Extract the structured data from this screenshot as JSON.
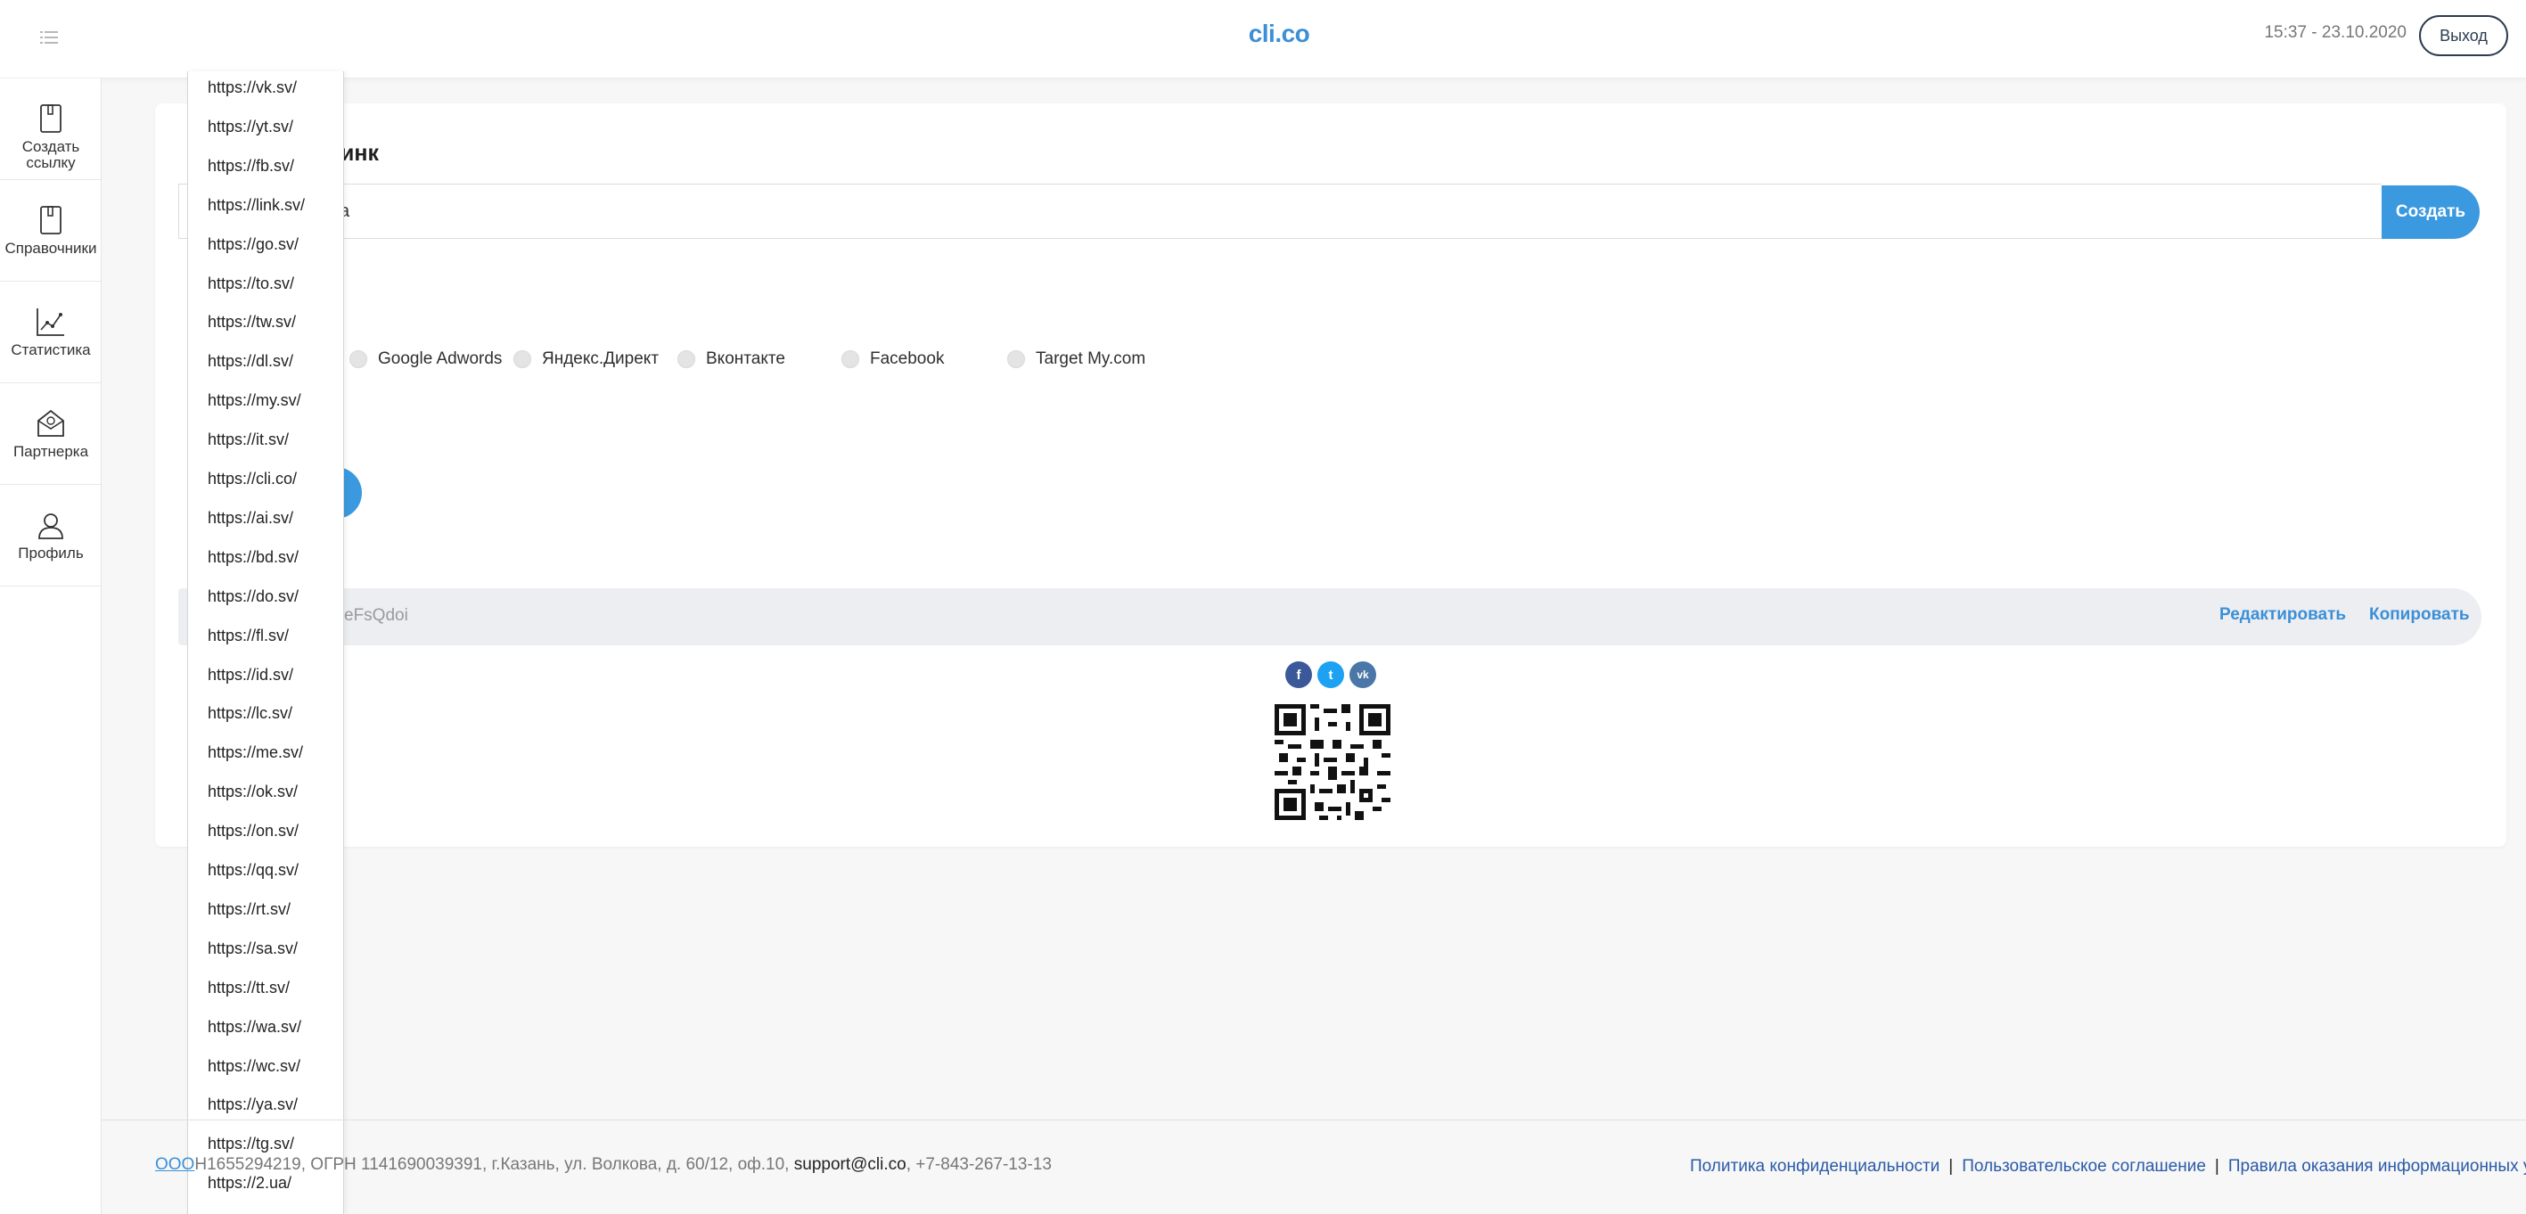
{
  "header": {
    "logo": "cli.co",
    "datetime": "15:37 - 23.10.2020",
    "logout_label": "Выход"
  },
  "sidebar": {
    "items": [
      {
        "label": "Создать\nссылку",
        "icon": "create-link-icon"
      },
      {
        "label": "Справочники",
        "icon": "book-icon"
      },
      {
        "label": "Статистика",
        "icon": "chart-icon"
      },
      {
        "label": "Партнерка",
        "icon": "partner-icon"
      },
      {
        "label": "Профиль",
        "icon": "profile-icon"
      }
    ]
  },
  "form": {
    "title_visible": "инк",
    "input_visible": "a",
    "create_label": "Создать",
    "sources": [
      "Google Adwords",
      "Яндекс.Директ",
      "Вконтакте",
      "Facebook",
      "Target My.com"
    ]
  },
  "result": {
    "short_link_visible": "eFsQdoi",
    "edit_label": "Редактировать",
    "copy_label": "Копировать",
    "share": [
      {
        "name": "facebook",
        "glyph": "f",
        "color": "#3b5998"
      },
      {
        "name": "twitter",
        "glyph": "t",
        "color": "#1da1f2"
      },
      {
        "name": "vk",
        "glyph": "vk",
        "color": "#4a76a8"
      }
    ]
  },
  "dropdown": {
    "domains": [
      "https://vk.sv/",
      "https://yt.sv/",
      "https://fb.sv/",
      "https://link.sv/",
      "https://go.sv/",
      "https://to.sv/",
      "https://tw.sv/",
      "https://dl.sv/",
      "https://my.sv/",
      "https://it.sv/",
      "https://cli.co/",
      "https://ai.sv/",
      "https://bd.sv/",
      "https://do.sv/",
      "https://fl.sv/",
      "https://id.sv/",
      "https://lc.sv/",
      "https://me.sv/",
      "https://ok.sv/",
      "https://on.sv/",
      "https://qq.sv/",
      "https://rt.sv/",
      "https://sa.sv/",
      "https://tt.sv/",
      "https://wa.sv/",
      "https://wc.sv/",
      "https://ya.sv/",
      "https://tg.sv/",
      "https://2.ua/"
    ]
  },
  "footer": {
    "company_link": "ООО",
    "company_info": "Н1655294219, ОГРН 1141690039391, г.Казань, ул. Волкова, д. 60/12, оф.10, ",
    "email": "support@cli.co",
    "phone": ", +7-843-267-13-13",
    "links": [
      "Политика конфиденциальности",
      "Пользовательское соглашение",
      "Правила оказания информационных услуг"
    ],
    "separator": "|"
  }
}
